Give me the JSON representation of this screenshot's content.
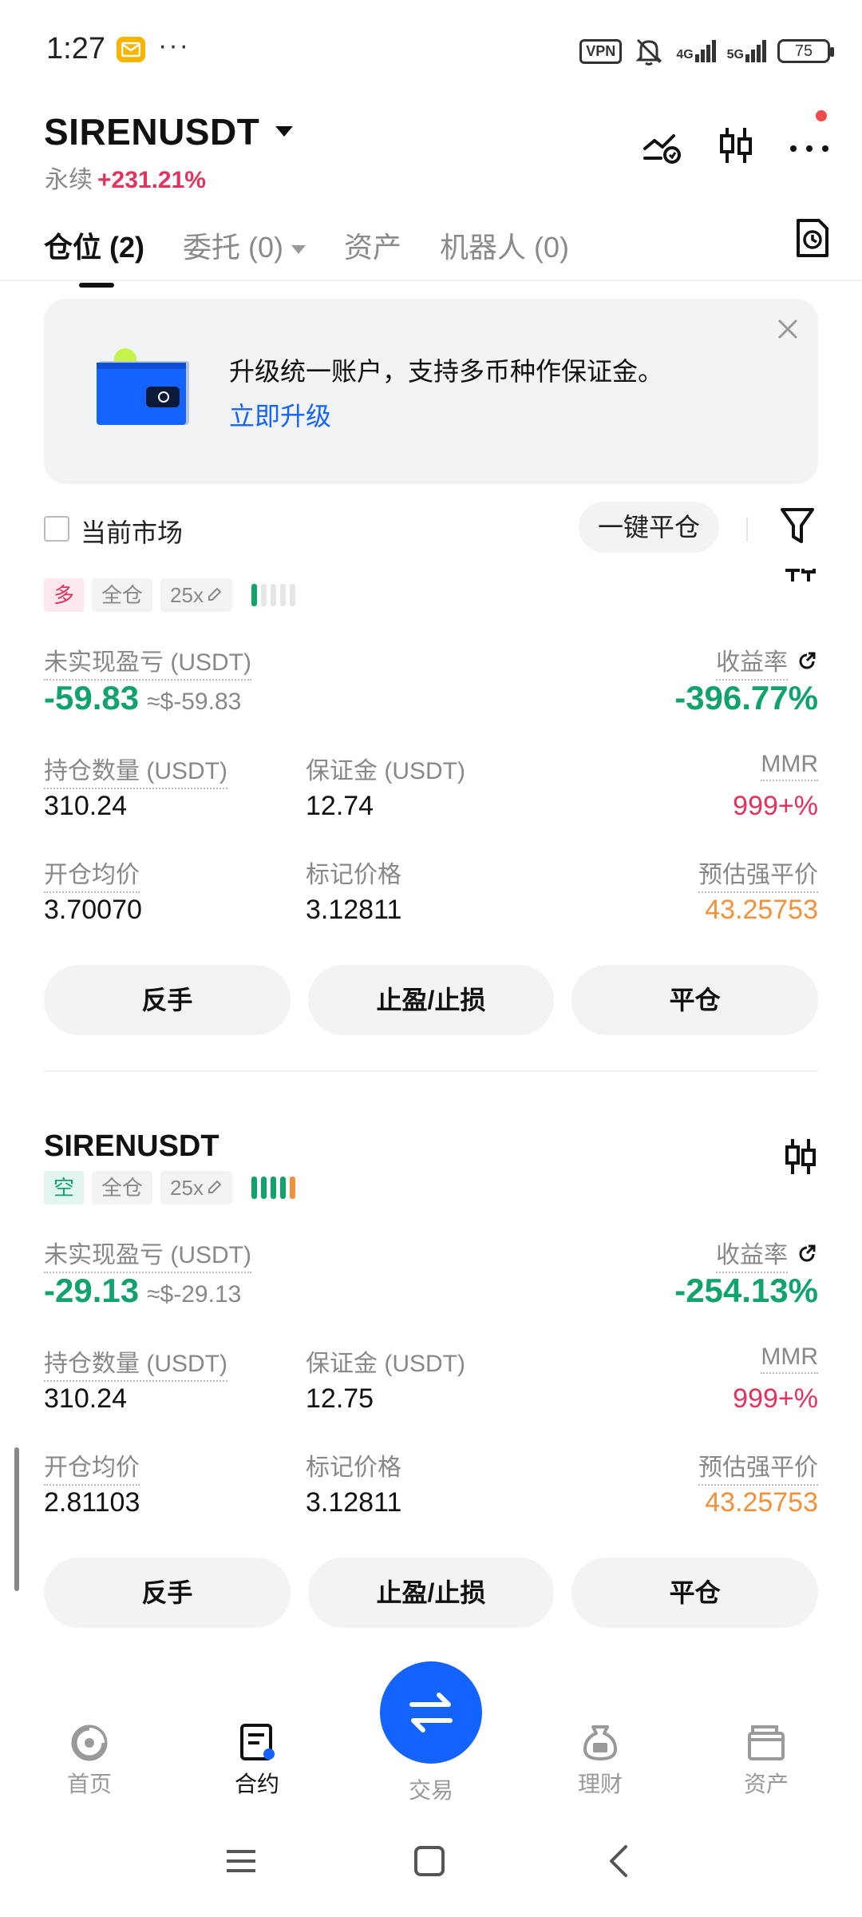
{
  "status_bar": {
    "time": "1:27",
    "dots": "···",
    "vpn": "VPN",
    "net1": "4G",
    "net2": "5G",
    "battery": "75"
  },
  "header": {
    "pair": "SIRENUSDT",
    "type": "永续",
    "change": "+231.21%",
    "icons": [
      "trade-analysis-icon",
      "candlestick-icon",
      "more-icon"
    ]
  },
  "tabs": [
    {
      "label": "仓位 (2)",
      "active": true
    },
    {
      "label": "委托 (0)"
    },
    {
      "label": "资产"
    },
    {
      "label": "机器人 (0)"
    }
  ],
  "banner": {
    "text": "升级统一账户，支持多币种作保证金。",
    "link": "立即升级"
  },
  "filter": {
    "market_label": "当前市场",
    "close_all": "一键平仓"
  },
  "labels": {
    "unrealized_pnl": "未实现盈亏 (USDT)",
    "roe": "收益率",
    "size": "持仓数量 (USDT)",
    "margin": "保证金 (USDT)",
    "mmr": "MMR",
    "entry": "开仓均价",
    "mark": "标记价格",
    "liq": "预估强平价",
    "btn_reverse": "反手",
    "btn_tpsl": "止盈/止损",
    "btn_close": "平仓"
  },
  "positions": [
    {
      "pair": "SIRENUSDT",
      "side": "多",
      "mode": "全仓",
      "leverage": "25x",
      "risk_level": 1,
      "pnl": "-59.83",
      "pnl_usd": "≈$-59.83",
      "roe": "-396.77%",
      "size": "310.24",
      "margin": "12.74",
      "mmr": "999+%",
      "entry": "3.70070",
      "mark": "3.12811",
      "liq": "43.25753"
    },
    {
      "pair": "SIRENUSDT",
      "side": "空",
      "mode": "全仓",
      "leverage": "25x",
      "risk_level": 5,
      "pnl": "-29.13",
      "pnl_usd": "≈$-29.13",
      "roe": "-254.13%",
      "size": "310.24",
      "margin": "12.75",
      "mmr": "999+%",
      "entry": "2.81103",
      "mark": "3.12811",
      "liq": "43.25753"
    }
  ],
  "bottom_nav": [
    {
      "label": "首页",
      "icon": "home-icon"
    },
    {
      "label": "合约",
      "icon": "futures-icon",
      "active": true
    },
    {
      "label": "交易",
      "icon": "swap-icon"
    },
    {
      "label": "理财",
      "icon": "earn-icon"
    },
    {
      "label": "资产",
      "icon": "wallet-icon"
    }
  ],
  "colors": {
    "green": "#12a36d",
    "red": "#e0335d",
    "orange": "#f0913b",
    "blue": "#1463ff"
  }
}
